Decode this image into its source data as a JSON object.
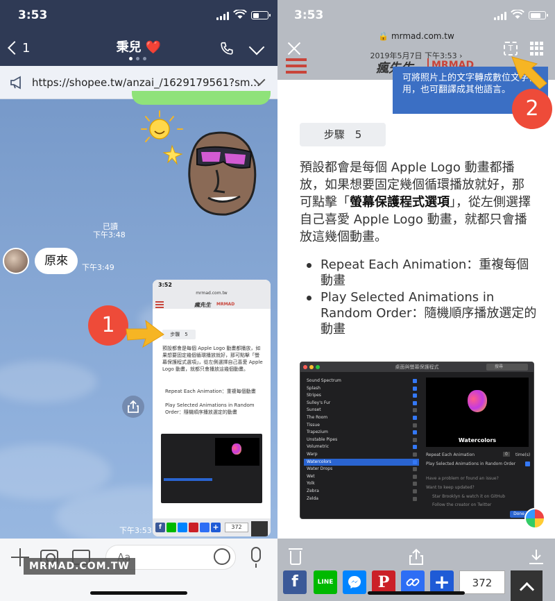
{
  "left": {
    "status_time": "3:53",
    "back_count": "1",
    "chat_title": "秉兒 ❤️",
    "url": "https://shopee.tw/anzai_/1629179561?sm...",
    "read_label": "已讀",
    "read_time": "下午3:48",
    "message": "原來",
    "message_time": "下午3:49",
    "thumb_time": "下午3:53",
    "input_placeholder": "Aa",
    "watermark": "MRMAD.COM.TW",
    "badge": "1"
  },
  "thumbnail": {
    "time": "3:52",
    "domain": "mrmad.com.tw",
    "brand": "瘋先生",
    "brand_en": "MRMAD",
    "step": "步驟　5",
    "para": "預設都會是每個 Apple Logo 動畫都播放，如果想要固定幾個循環播放就好，那可點擊「螢幕保護程式選項」，從左側選擇自己喜愛 Apple Logo 動畫，就都只會播放這幾個動畫。",
    "bullet1": "Repeat Each Animation：重複每個動畫",
    "bullet2": "Play Selected Animations in Random Order：隨機順序播放選定的動畫",
    "share_count": "372"
  },
  "right": {
    "status_time": "3:53",
    "domain": "mrmad.com.tw",
    "date": "2019年5月7日 下午3:53 ›",
    "brand": "瘋先生",
    "brand_en": "MRMAD",
    "tooltip": "可將照片上的文字轉成數位文字使用，也可翻譯成其他語言。",
    "badge": "2",
    "step": "步驟　5",
    "para_1": "預設都會是每個 Apple Logo 動畫都播放，如果想要固定幾個循環播放就好，那可點擊「",
    "para_bold": "螢幕保護程式選項",
    "para_2": "」，從左側選擇自己喜愛 Apple Logo 動畫，就都只會播放這幾個動畫。",
    "bullet1": "Repeat Each Animation：重複每個動畫",
    "bullet2": "Play Selected Animations in Random Order：隨機順序播放選定的動畫",
    "share_count": "372",
    "line_label": "LINE"
  },
  "mac": {
    "window_title": "桌面與螢幕保護程式",
    "search_placeholder": "搜尋",
    "items": [
      {
        "name": "Sound Spectrum",
        "checked": true
      },
      {
        "name": "Splash",
        "checked": true
      },
      {
        "name": "Stripes",
        "checked": true
      },
      {
        "name": "Sulley's Fur",
        "checked": true
      },
      {
        "name": "Sunset",
        "checked": false
      },
      {
        "name": "The Room",
        "checked": true
      },
      {
        "name": "Tissue",
        "checked": false
      },
      {
        "name": "Trapezium",
        "checked": true
      },
      {
        "name": "Unstable Pipes",
        "checked": false
      },
      {
        "name": "Volumetric",
        "checked": true
      },
      {
        "name": "Warp",
        "checked": false
      },
      {
        "name": "Watercolors",
        "checked": true,
        "selected": true
      },
      {
        "name": "Water Drops",
        "checked": false
      },
      {
        "name": "Wet",
        "checked": false
      },
      {
        "name": "Yolk",
        "checked": false
      },
      {
        "name": "Zebra",
        "checked": false
      },
      {
        "name": "Zelda",
        "checked": false
      }
    ],
    "preview_caption": "Watercolors",
    "repeat_label": "Repeat Each Animation",
    "repeat_value": "0",
    "repeat_unit": "time(s)",
    "random_label": "Play Selected Animations in Random Order",
    "problem_text": "Have a problem or found an issue?",
    "updated_text": "Want to keep updated?",
    "star_text": "Star Brooklyn & watch it on GitHub",
    "follow_text": "Follow the creator on Twitter",
    "done": "Done",
    "colors": {
      "close": "#ff5f57",
      "min": "#febc2e",
      "max": "#28c840",
      "accent": "#2a64d0"
    }
  },
  "colors": {
    "line_header": "#2f3a55",
    "badge": "#ee4b39",
    "tooltip": "#3b6fc4",
    "arrow": "#f6b524",
    "facebook": "#3b5998",
    "line": "#00b900",
    "messenger": "#0084ff",
    "pinterest": "#cb2027",
    "link": "#2d6ef5",
    "plus": "#1f5bd6"
  }
}
